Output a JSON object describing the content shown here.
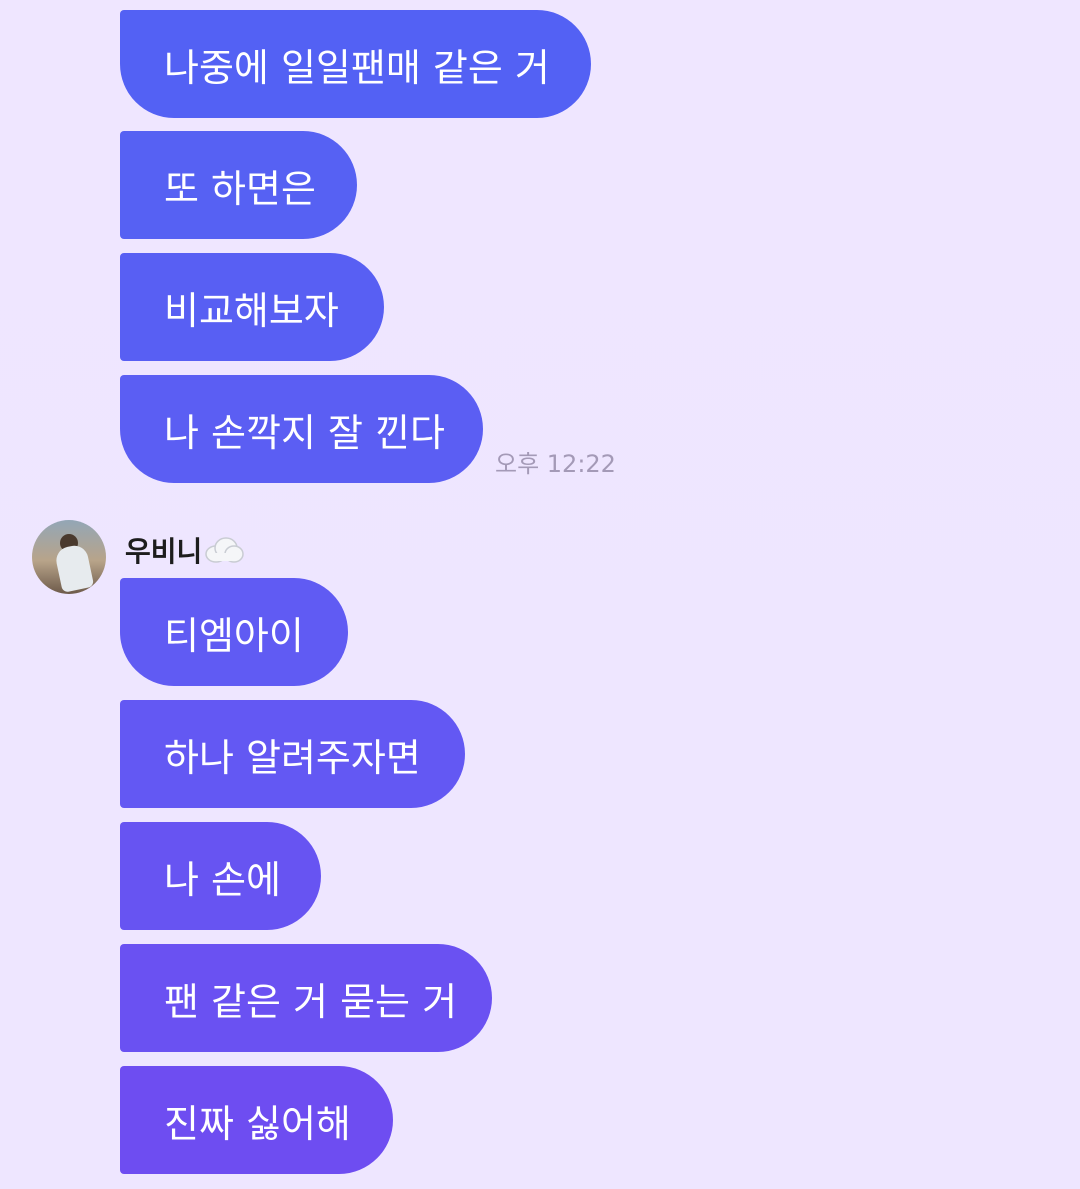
{
  "messages_top": [
    {
      "text": "나중에 일일팬매 같은 거"
    },
    {
      "text": "또 하면은"
    },
    {
      "text": "비교해보자"
    },
    {
      "text": "나 손깍지 잘 낀다",
      "time": "오후 12:22"
    }
  ],
  "sender": {
    "name": "우비니",
    "name_icon": "cloud-icon"
  },
  "messages_bottom": [
    {
      "text": "티엠아이"
    },
    {
      "text": "하나 알려주자면"
    },
    {
      "text": "나 손에"
    },
    {
      "text": "팬 같은 거 묻는 거"
    },
    {
      "text": "진짜 싫어해"
    }
  ],
  "colors": {
    "background": "#efe7fd",
    "bubble_top": "#5660f2",
    "bubble_bottom": "#7248f0",
    "time_text": "#a49ab7"
  }
}
